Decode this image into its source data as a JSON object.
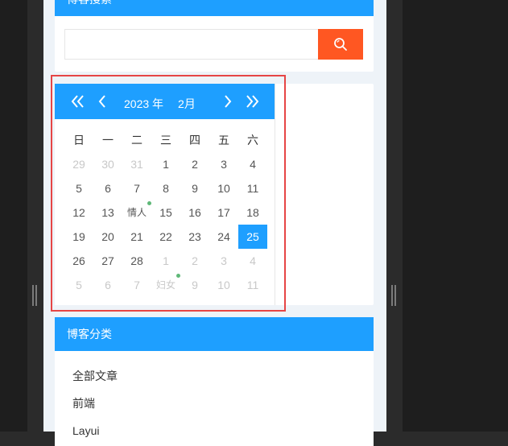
{
  "search": {
    "title": "博客搜索",
    "value": "",
    "placeholder": ""
  },
  "calendar": {
    "year_label": "2023 年",
    "month_label": "2月",
    "weekdays": [
      "日",
      "一",
      "二",
      "三",
      "四",
      "五",
      "六"
    ],
    "rows": [
      [
        {
          "t": "29",
          "o": true
        },
        {
          "t": "30",
          "o": true
        },
        {
          "t": "31",
          "o": true
        },
        {
          "t": "1"
        },
        {
          "t": "2"
        },
        {
          "t": "3"
        },
        {
          "t": "4"
        }
      ],
      [
        {
          "t": "5"
        },
        {
          "t": "6"
        },
        {
          "t": "7"
        },
        {
          "t": "8"
        },
        {
          "t": "9"
        },
        {
          "t": "10"
        },
        {
          "t": "11"
        }
      ],
      [
        {
          "t": "12"
        },
        {
          "t": "13"
        },
        {
          "t": "情人",
          "m": true
        },
        {
          "t": "15"
        },
        {
          "t": "16"
        },
        {
          "t": "17"
        },
        {
          "t": "18"
        }
      ],
      [
        {
          "t": "19"
        },
        {
          "t": "20"
        },
        {
          "t": "21"
        },
        {
          "t": "22"
        },
        {
          "t": "23"
        },
        {
          "t": "24"
        },
        {
          "t": "25",
          "s": true
        }
      ],
      [
        {
          "t": "26"
        },
        {
          "t": "27"
        },
        {
          "t": "28"
        },
        {
          "t": "1",
          "o": true
        },
        {
          "t": "2",
          "o": true
        },
        {
          "t": "3",
          "o": true
        },
        {
          "t": "4",
          "o": true
        }
      ],
      [
        {
          "t": "5",
          "o": true
        },
        {
          "t": "6",
          "o": true
        },
        {
          "t": "7",
          "o": true
        },
        {
          "t": "妇女",
          "o": true,
          "m": true
        },
        {
          "t": "9",
          "o": true
        },
        {
          "t": "10",
          "o": true
        },
        {
          "t": "11",
          "o": true
        }
      ]
    ],
    "accent_color": "#1e9fff",
    "marker_color": "#5fb878"
  },
  "categories": {
    "title": "博客分类",
    "items": [
      "全部文章",
      "前端",
      "Layui"
    ]
  },
  "colors": {
    "header_blue": "#1e9fff",
    "search_button": "#ff5722",
    "highlight_border": "#e64545"
  },
  "icons": {
    "search_button": "search-icon",
    "prev_year": "double-chevron-left-icon",
    "prev_month": "chevron-left-icon",
    "next_month": "chevron-right-icon",
    "next_year": "double-chevron-right-icon"
  }
}
